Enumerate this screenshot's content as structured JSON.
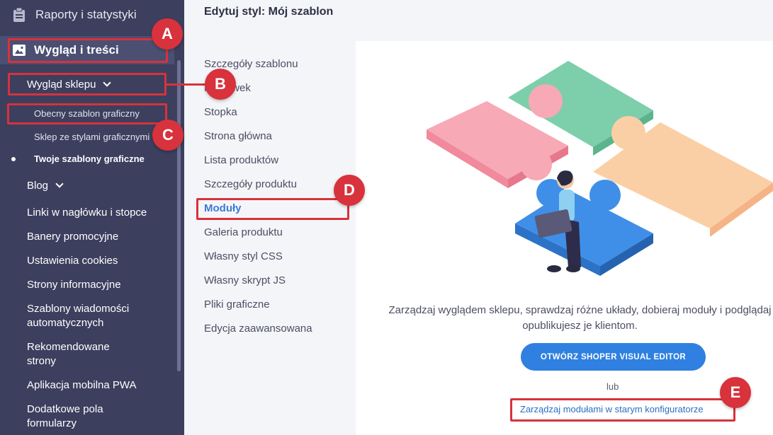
{
  "sidebar": {
    "top_item": "Raporty i statystyki",
    "active_section": "Wygląd i treści",
    "submenu_parent": "Wygląd sklepu",
    "sub_items": [
      "Obecny szablon graficzny",
      "Sklep ze stylami graficznymi",
      "Twoje szablony graficzne"
    ],
    "items": [
      {
        "label": "Blog"
      },
      {
        "label": "Linki w nagłówku i stopce"
      },
      {
        "label": "Banery promocyjne"
      },
      {
        "label": "Ustawienia cookies"
      },
      {
        "label": "Strony informacyjne"
      },
      {
        "label": "Szablony wiadomości\nautomatycznych"
      },
      {
        "label": "Rekomendowane\nstrony"
      },
      {
        "label": "Aplikacja mobilna PWA"
      },
      {
        "label": "Dodatkowe pola\nformularzy"
      }
    ]
  },
  "header": {
    "title": "Edytuj styl: Mój szablon"
  },
  "menu": {
    "items": [
      "Szczegóły szablonu",
      "Nagłówek",
      "Stopka",
      "Strona główna",
      "Lista produktów",
      "Szczegóły produktu",
      "Moduły",
      "Galeria produktu",
      "Własny styl CSS",
      "Własny skrypt JS",
      "Pliki graficzne",
      "Edycja zaawansowana"
    ],
    "active": "Moduły"
  },
  "panel": {
    "description_line1": "Zarządzaj wyglądem sklepu, sprawdzaj różne układy, dobieraj moduły i podglądaj",
    "description_line2": "opublikujesz je klientom.",
    "cta_label": "OTWÓRZ SHOPER VISUAL EDITOR",
    "or_text": "lub",
    "link_label": "Zarządzaj modułami w starym konfiguratorze"
  },
  "annotations": {
    "badges": [
      "A",
      "B",
      "C",
      "D",
      "E"
    ]
  },
  "colors": {
    "sidebar_bg": "#3c3f5e",
    "accent": "#2f80e0",
    "highlight": "#d8323c"
  }
}
